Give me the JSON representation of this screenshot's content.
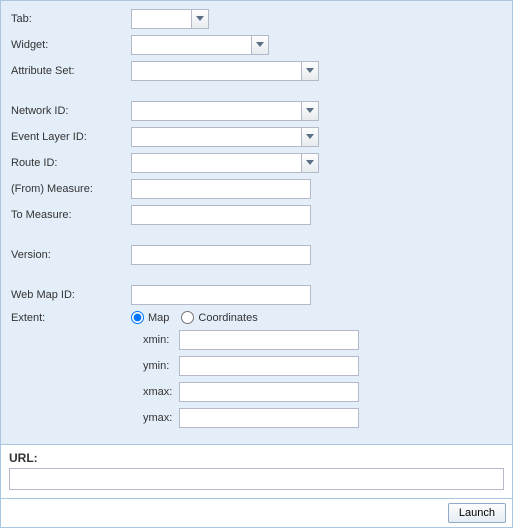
{
  "labels": {
    "tab": "Tab:",
    "widget": "Widget:",
    "attributeSet": "Attribute Set:",
    "networkId": "Network ID:",
    "eventLayerId": "Event Layer ID:",
    "routeId": "Route ID:",
    "fromMeasure": "(From) Measure:",
    "toMeasure": "To Measure:",
    "version": "Version:",
    "webMapId": "Web Map ID:",
    "extent": "Extent:",
    "xmin": "xmin:",
    "ymin": "ymin:",
    "xmax": "xmax:",
    "ymax": "ymax:",
    "url": "URL:"
  },
  "radios": {
    "map": "Map",
    "coordinates": "Coordinates"
  },
  "values": {
    "tab": "",
    "widget": "",
    "attributeSet": "",
    "networkId": "",
    "eventLayerId": "",
    "routeId": "",
    "fromMeasure": "",
    "toMeasure": "",
    "version": "",
    "webMapId": "",
    "xmin": "",
    "ymin": "",
    "xmax": "",
    "ymax": "",
    "url": "",
    "extentMode": "map"
  },
  "buttons": {
    "launch": "Launch"
  }
}
